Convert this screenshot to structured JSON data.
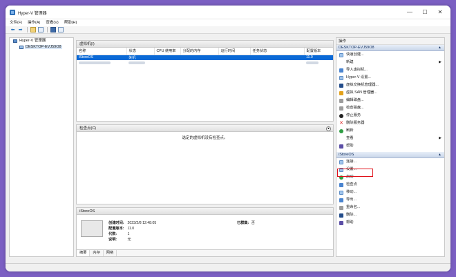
{
  "window": {
    "title": "Hyper-V 管理器"
  },
  "menu": [
    "文件(F)",
    "操作(A)",
    "查看(V)",
    "帮助(H)"
  ],
  "tree": {
    "root": "Hyper-V 管理器",
    "host": "DESKTOP-EVJ59O8"
  },
  "vm_panel": {
    "title": "虚拟机(I)",
    "columns": [
      "名称",
      "状态",
      "CPU 使用率",
      "分配的内存",
      "运行时间",
      "任务状态",
      "配置版本"
    ],
    "rows": [
      {
        "name": "iStoreOS",
        "state": "关机",
        "version": "11.0",
        "selected": true
      },
      {
        "name": "",
        "state": "",
        "version": "",
        "selected": false
      }
    ]
  },
  "checkpoint_panel": {
    "title": "检查点(C)",
    "message": "选定的虚拟机没有检查点。"
  },
  "detail_panel": {
    "title": "iStoreOS",
    "fields": [
      {
        "key": "创建时间:",
        "value": "2023/2/8 12:48:05"
      },
      {
        "key": "配置版本:",
        "value": "11.0"
      },
      {
        "key": "代数:",
        "value": "1"
      },
      {
        "key": "说明:",
        "value": "无"
      }
    ],
    "clustered": {
      "key": "已群集:",
      "value": "否"
    },
    "tabs": [
      "摘要",
      "内存",
      "网络"
    ]
  },
  "actions": {
    "title": "操作",
    "host_section": "DESKTOP-EVJ59O8",
    "host_items": [
      {
        "label": "快速创建...",
        "icon": "quick-create-icon",
        "submenu": false
      },
      {
        "label": "新建",
        "icon": "new-icon",
        "submenu": true
      },
      {
        "label": "导入虚拟机...",
        "icon": "import-vm-icon",
        "submenu": false
      },
      {
        "label": "Hyper-V 设置...",
        "icon": "hyperv-settings-icon",
        "submenu": false
      },
      {
        "label": "虚拟交换机管理器...",
        "icon": "virtual-switch-icon",
        "submenu": false
      },
      {
        "label": "虚拟 SAN 管理器...",
        "icon": "virtual-san-icon",
        "submenu": false
      },
      {
        "label": "编辑磁盘...",
        "icon": "edit-disk-icon",
        "submenu": false
      },
      {
        "label": "检查磁盘...",
        "icon": "inspect-disk-icon",
        "submenu": false
      },
      {
        "label": "停止服务",
        "icon": "stop-service-icon",
        "submenu": false
      },
      {
        "label": "删除服务器",
        "icon": "remove-server-icon",
        "submenu": false
      },
      {
        "label": "刷新",
        "icon": "refresh-icon",
        "submenu": false
      },
      {
        "label": "查看",
        "icon": "view-icon",
        "submenu": true
      },
      {
        "label": "帮助",
        "icon": "help-icon",
        "submenu": false
      }
    ],
    "vm_section": "iStoreOS",
    "vm_items": [
      {
        "label": "连接...",
        "icon": "connect-icon"
      },
      {
        "label": "设置...",
        "icon": "settings-icon"
      },
      {
        "label": "启动",
        "icon": "start-icon"
      },
      {
        "label": "检查点",
        "icon": "checkpoint-icon"
      },
      {
        "label": "移动...",
        "icon": "move-icon"
      },
      {
        "label": "导出...",
        "icon": "export-icon"
      },
      {
        "label": "重命名...",
        "icon": "rename-icon"
      },
      {
        "label": "删除...",
        "icon": "delete-icon"
      },
      {
        "label": "帮助",
        "icon": "help-icon"
      }
    ]
  }
}
